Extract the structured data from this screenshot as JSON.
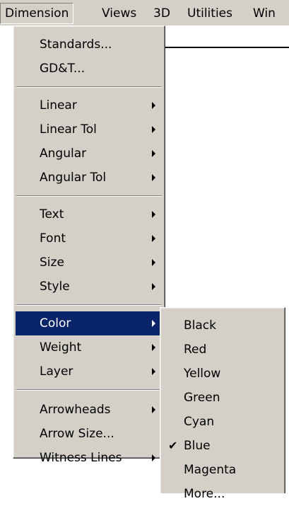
{
  "menubar": {
    "items": [
      "Dimension",
      "Views",
      "3D",
      "Utilities",
      "Win"
    ],
    "active": "Dimension"
  },
  "dimension_menu": {
    "items": [
      {
        "label": "Standards...",
        "submenu": false
      },
      {
        "label": "GD&T...",
        "submenu": false
      },
      {
        "label": "Linear",
        "submenu": true
      },
      {
        "label": "Linear Tol",
        "submenu": true
      },
      {
        "label": "Angular",
        "submenu": true
      },
      {
        "label": "Angular Tol",
        "submenu": true
      },
      {
        "label": "Text",
        "submenu": true
      },
      {
        "label": "Font",
        "submenu": true
      },
      {
        "label": "Size",
        "submenu": true
      },
      {
        "label": "Style",
        "submenu": true
      },
      {
        "label": "Color",
        "submenu": true,
        "highlighted": true
      },
      {
        "label": "Weight",
        "submenu": true
      },
      {
        "label": "Layer",
        "submenu": true
      },
      {
        "label": "Arrowheads",
        "submenu": true
      },
      {
        "label": "Arrow Size...",
        "submenu": false
      },
      {
        "label": "Witness Lines",
        "submenu": true
      }
    ]
  },
  "color_submenu": {
    "items": [
      {
        "label": "Black",
        "checked": false
      },
      {
        "label": "Red",
        "checked": false
      },
      {
        "label": "Yellow",
        "checked": false
      },
      {
        "label": "Green",
        "checked": false
      },
      {
        "label": "Cyan",
        "checked": false
      },
      {
        "label": "Blue",
        "checked": true
      },
      {
        "label": "Magenta",
        "checked": false
      },
      {
        "label": "More...",
        "checked": false
      }
    ],
    "check_glyph": "✔"
  },
  "colors": {
    "menu_bg": "#d4d0c8",
    "highlight_bg": "#0a246a",
    "highlight_text": "#ffffff"
  }
}
